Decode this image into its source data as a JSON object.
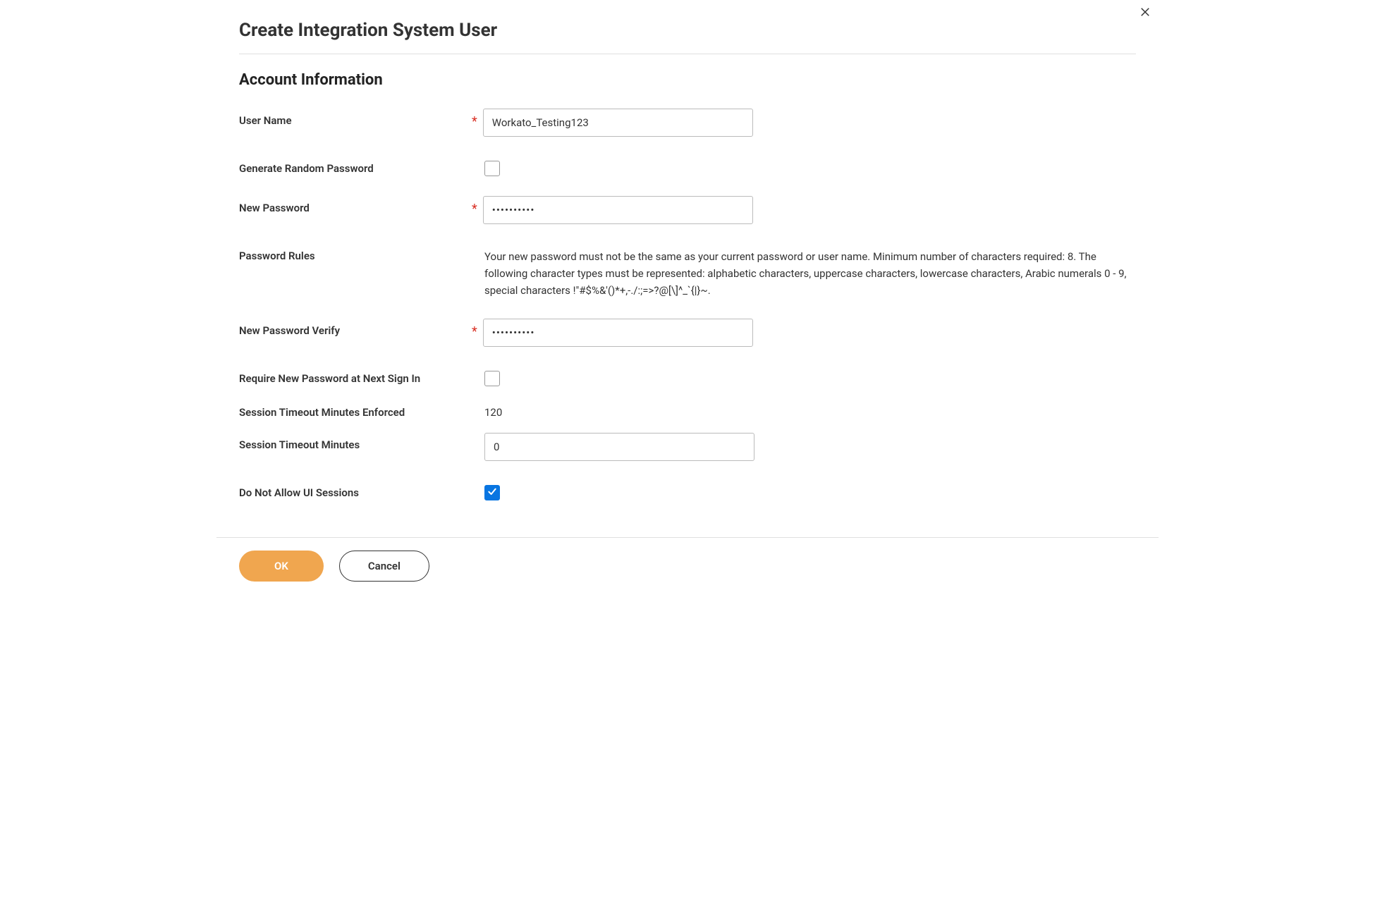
{
  "dialog": {
    "title": "Create Integration System User",
    "section_title": "Account Information"
  },
  "form": {
    "username": {
      "label": "User Name",
      "value": "Workato_Testing123",
      "required": true
    },
    "generate_random": {
      "label": "Generate Random Password",
      "checked": false
    },
    "new_password": {
      "label": "New Password",
      "value": "••••••••••",
      "required": true
    },
    "password_rules": {
      "label": "Password Rules",
      "text": "Your new password must not be the same as your current password or user name. Minimum number of characters required: 8. The following character types must be represented: alphabetic characters, uppercase characters, lowercase characters, Arabic numerals 0 - 9, special characters !\"#$%&'()*+,-./:;=>?@[\\]^_`{|}~."
    },
    "new_password_verify": {
      "label": "New Password Verify",
      "value": "••••••••••",
      "required": true
    },
    "require_new_password": {
      "label": "Require New Password at Next Sign In",
      "checked": false
    },
    "session_timeout_enforced": {
      "label": "Session Timeout Minutes Enforced",
      "value": "120"
    },
    "session_timeout": {
      "label": "Session Timeout Minutes",
      "value": "0"
    },
    "no_ui_sessions": {
      "label": "Do Not Allow UI Sessions",
      "checked": true
    }
  },
  "buttons": {
    "ok": "OK",
    "cancel": "Cancel"
  }
}
